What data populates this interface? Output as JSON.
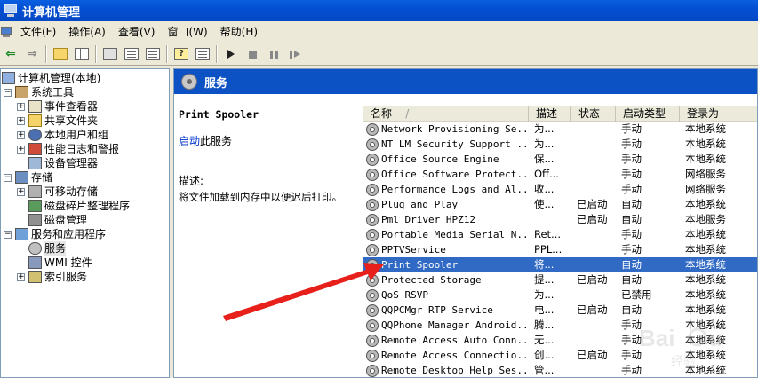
{
  "window": {
    "title": "计算机管理"
  },
  "menu": [
    {
      "label": "文件(F)"
    },
    {
      "label": "操作(A)"
    },
    {
      "label": "查看(V)"
    },
    {
      "label": "窗口(W)"
    },
    {
      "label": "帮助(H)"
    }
  ],
  "tree": {
    "root": "计算机管理(本地)",
    "items": [
      {
        "label": "系统工具",
        "level": 1,
        "expander": "−",
        "icon": "tools"
      },
      {
        "label": "事件查看器",
        "level": 2,
        "expander": "+",
        "icon": "event"
      },
      {
        "label": "共享文件夹",
        "level": 2,
        "expander": "+",
        "icon": "share"
      },
      {
        "label": "本地用户和组",
        "level": 2,
        "expander": "+",
        "icon": "users"
      },
      {
        "label": "性能日志和警报",
        "level": 2,
        "expander": "+",
        "icon": "perf"
      },
      {
        "label": "设备管理器",
        "level": 2,
        "expander": "",
        "icon": "dev"
      },
      {
        "label": "存储",
        "level": 1,
        "expander": "−",
        "icon": "storage"
      },
      {
        "label": "可移动存储",
        "level": 2,
        "expander": "+",
        "icon": "removable"
      },
      {
        "label": "磁盘碎片整理程序",
        "level": 2,
        "expander": "",
        "icon": "defrag"
      },
      {
        "label": "磁盘管理",
        "level": 2,
        "expander": "",
        "icon": "disk"
      },
      {
        "label": "服务和应用程序",
        "level": 1,
        "expander": "−",
        "icon": "svcapp"
      },
      {
        "label": "服务",
        "level": 2,
        "expander": "",
        "icon": "gears",
        "selected": true
      },
      {
        "label": "WMI 控件",
        "level": 2,
        "expander": "",
        "icon": "wmi"
      },
      {
        "label": "索引服务",
        "level": 2,
        "expander": "+",
        "icon": "index"
      }
    ]
  },
  "services_panel": {
    "header": "服务",
    "selected_service": "Print Spooler",
    "start_link": "启动",
    "start_suffix": "此服务",
    "desc_label": "描述:",
    "desc_text": "将文件加载到内存中以便迟后打印。"
  },
  "list": {
    "columns": [
      "名称",
      "描述",
      "状态",
      "启动类型",
      "登录为"
    ],
    "sort_indicator": "/",
    "rows": [
      {
        "name": "Network Provisioning Se...",
        "desc": "为...",
        "status": "",
        "start": "手动",
        "logon": "本地系统"
      },
      {
        "name": "NT LM Security Support ...",
        "desc": "为...",
        "status": "",
        "start": "手动",
        "logon": "本地系统"
      },
      {
        "name": "Office  Source Engine",
        "desc": "保...",
        "status": "",
        "start": "手动",
        "logon": "本地系统"
      },
      {
        "name": "Office Software Protect...",
        "desc": "Off...",
        "status": "",
        "start": "手动",
        "logon": "网络服务"
      },
      {
        "name": "Performance Logs and Al...",
        "desc": "收...",
        "status": "",
        "start": "手动",
        "logon": "网络服务"
      },
      {
        "name": "Plug and Play",
        "desc": "使...",
        "status": "已启动",
        "start": "自动",
        "logon": "本地系统"
      },
      {
        "name": "Pml Driver HPZ12",
        "desc": "",
        "status": "已启动",
        "start": "自动",
        "logon": "本地服务"
      },
      {
        "name": "Portable Media Serial N...",
        "desc": "Ret...",
        "status": "",
        "start": "手动",
        "logon": "本地系统"
      },
      {
        "name": "PPTVService",
        "desc": "PPL...",
        "status": "",
        "start": "手动",
        "logon": "本地系统"
      },
      {
        "name": "Print Spooler",
        "desc": "将...",
        "status": "",
        "start": "自动",
        "logon": "本地系统",
        "selected": true
      },
      {
        "name": "Protected Storage",
        "desc": "提...",
        "status": "已启动",
        "start": "自动",
        "logon": "本地系统"
      },
      {
        "name": "QoS RSVP",
        "desc": "为...",
        "status": "",
        "start": "已禁用",
        "logon": "本地系统"
      },
      {
        "name": "QQPCMgr RTP Service",
        "desc": "电...",
        "status": "已启动",
        "start": "自动",
        "logon": "本地系统"
      },
      {
        "name": "QQPhone Manager Android...",
        "desc": "腾...",
        "status": "",
        "start": "手动",
        "logon": "本地系统"
      },
      {
        "name": "Remote Access Auto Conn...",
        "desc": "无...",
        "status": "",
        "start": "手动",
        "logon": "本地系统"
      },
      {
        "name": "Remote Access Connectio...",
        "desc": "创...",
        "status": "已启动",
        "start": "手动",
        "logon": "本地系统"
      },
      {
        "name": "Remote Desktop Help Ses...",
        "desc": "管...",
        "status": "",
        "start": "手动",
        "logon": "本地系统"
      }
    ]
  },
  "colors": {
    "selection": "#316ac5",
    "header_blue": "#0c52c4",
    "annotation": "#e8201c"
  },
  "watermark": "Baidu 经验"
}
